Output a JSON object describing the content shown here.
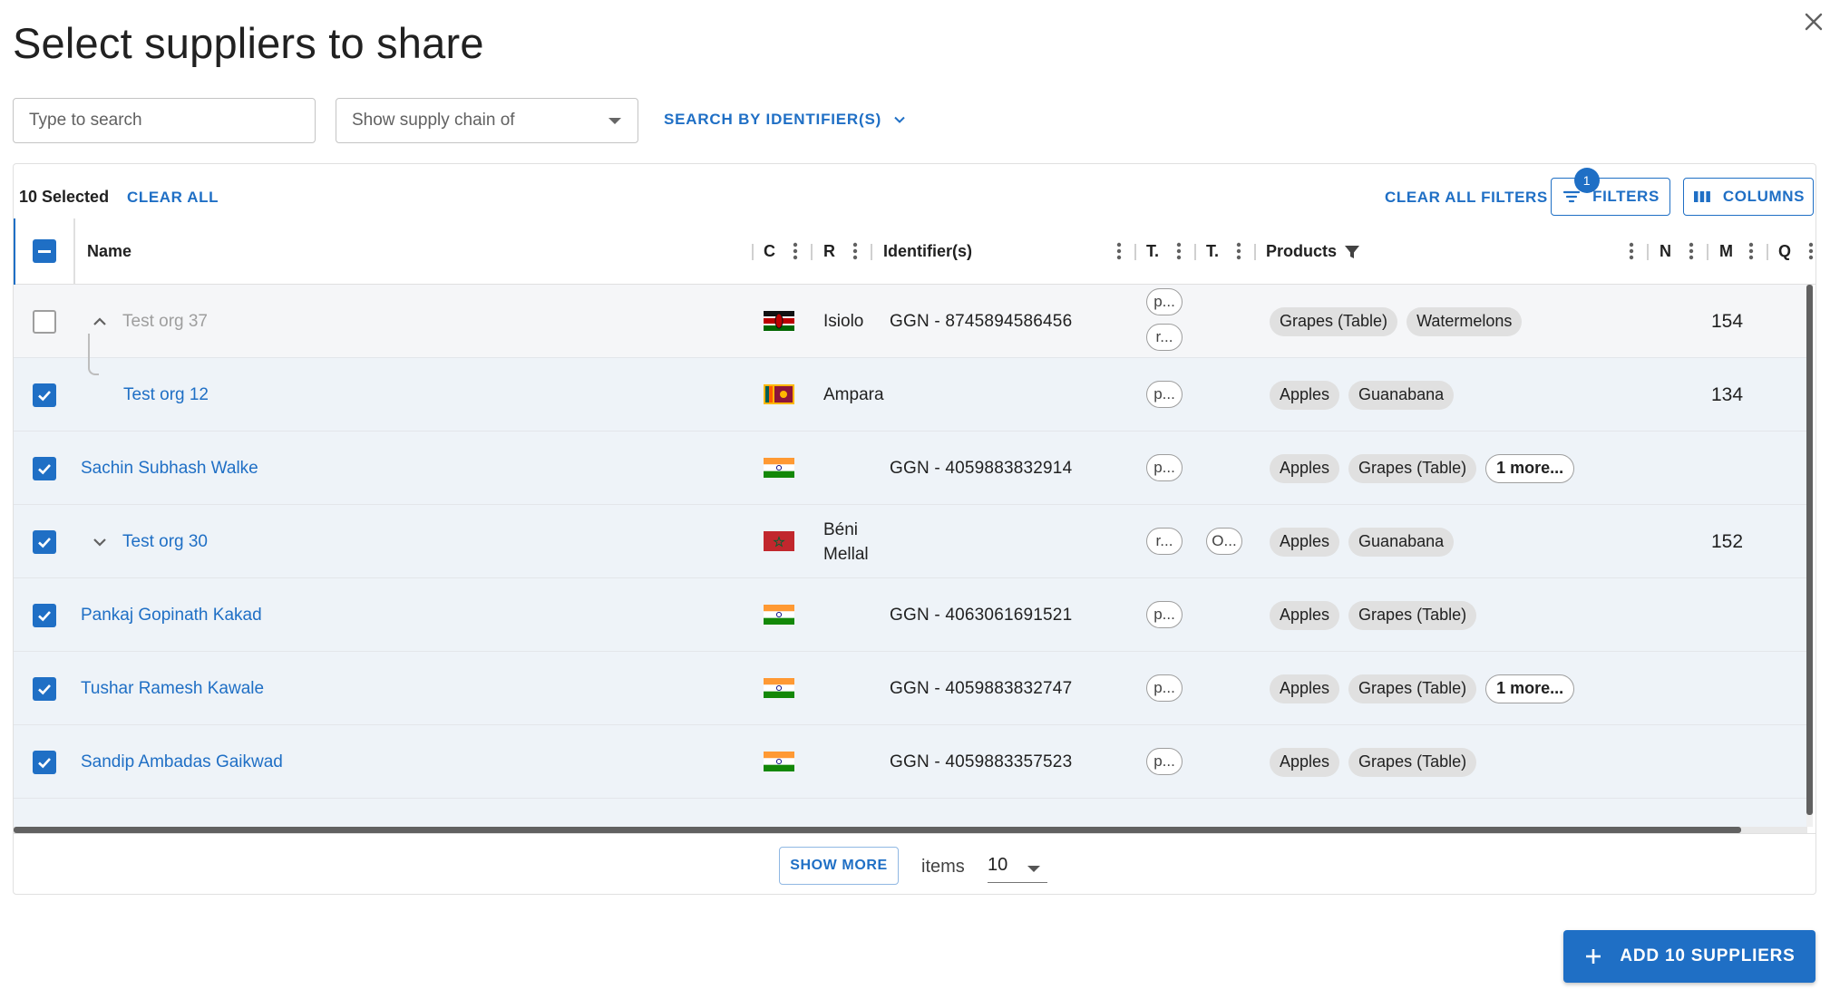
{
  "dialog": {
    "title": "Select suppliers to share"
  },
  "search": {
    "placeholder": "Type to search"
  },
  "supply_chain": {
    "placeholder": "Show supply chain of"
  },
  "search_identifiers": {
    "label": "SEARCH BY IDENTIFIER(S)"
  },
  "toolbar": {
    "selected_count": "10 Selected",
    "clear_all": "CLEAR ALL",
    "clear_all_filters": "CLEAR ALL FILTERS",
    "filters_label": "FILTERS",
    "filters_badge": "1",
    "columns_label": "COLUMNS"
  },
  "columns": {
    "name": "Name",
    "c": "C",
    "r": "R",
    "identifiers": "Identifier(s)",
    "t1": "T.",
    "t2": "T.",
    "products": "Products",
    "n": "N",
    "m": "M",
    "q": "Q"
  },
  "rows": [
    {
      "name": "Test org 37",
      "checked": false,
      "flag": "kenya",
      "region": "Isiolo",
      "identifier": "GGN - 8745894586456",
      "t1": [
        "p...",
        "r..."
      ],
      "t2": [],
      "products": [
        "Grapes (Table)",
        "Watermelons"
      ],
      "more": "",
      "m": "154"
    },
    {
      "name": "Test org 12",
      "checked": true,
      "flag": "sri-lanka",
      "region": "Ampara",
      "identifier": "",
      "t1": [
        "p..."
      ],
      "t2": [],
      "products": [
        "Apples",
        "Guanabana"
      ],
      "more": "",
      "m": "134"
    },
    {
      "name": "Sachin Subhash Walke",
      "checked": true,
      "flag": "india",
      "region": "",
      "identifier": "GGN - 4059883832914",
      "t1": [
        "p..."
      ],
      "t2": [],
      "products": [
        "Apples",
        "Grapes (Table)"
      ],
      "more": "1 more...",
      "m": ""
    },
    {
      "name": "Test org 30",
      "checked": true,
      "flag": "morocco",
      "region_line1": "Béni",
      "region_line2": "Mellal",
      "identifier": "",
      "t1": [
        "r..."
      ],
      "t2": [
        "O..."
      ],
      "products": [
        "Apples",
        "Guanabana"
      ],
      "more": "",
      "m": "152"
    },
    {
      "name": "Pankaj Gopinath Kakad",
      "checked": true,
      "flag": "india",
      "region": "",
      "identifier": "GGN - 4063061691521",
      "t1": [
        "p..."
      ],
      "t2": [],
      "products": [
        "Apples",
        "Grapes (Table)"
      ],
      "more": "",
      "m": ""
    },
    {
      "name": "Tushar Ramesh Kawale",
      "checked": true,
      "flag": "india",
      "region": "",
      "identifier": "GGN - 4059883832747",
      "t1": [
        "p..."
      ],
      "t2": [],
      "products": [
        "Apples",
        "Grapes (Table)"
      ],
      "more": "1 more...",
      "m": ""
    },
    {
      "name": "Sandip Ambadas Gaikwad",
      "checked": true,
      "flag": "india",
      "region": "",
      "identifier": "GGN - 4059883357523",
      "t1": [
        "p..."
      ],
      "t2": [],
      "products": [
        "Apples",
        "Grapes (Table)"
      ],
      "more": "",
      "m": ""
    }
  ],
  "footer": {
    "show_more": "SHOW MORE",
    "items_label": "items",
    "items_value": "10"
  },
  "actions": {
    "add_label": "ADD 10 SUPPLIERS"
  },
  "colors": {
    "primary": "#1f6fc5",
    "selected_row": "#eef3f8"
  }
}
